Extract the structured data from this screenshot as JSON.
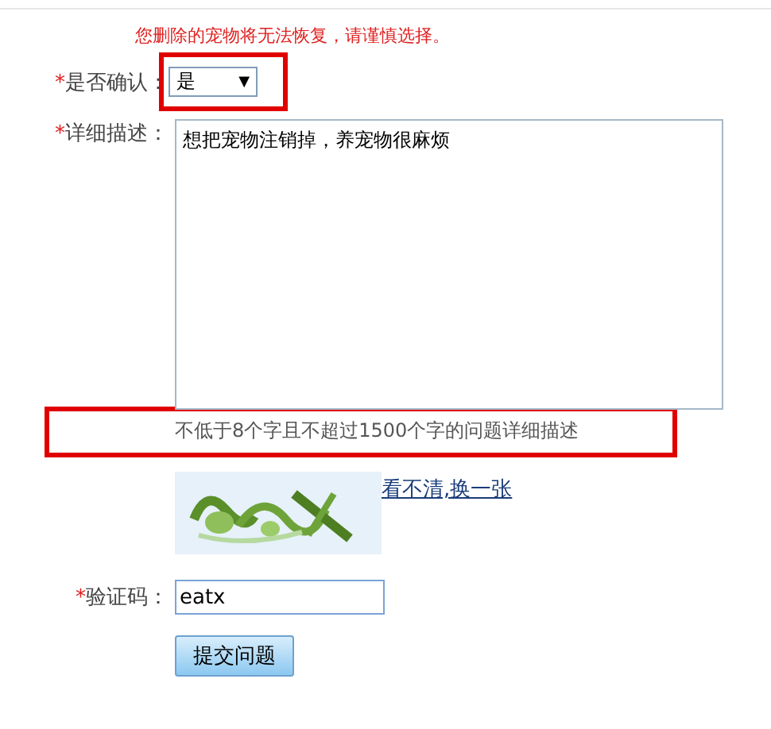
{
  "notice": "您删除的宠物将无法恢复，请谨慎选择。",
  "confirm": {
    "required_mark": "*",
    "label": "是否确认：",
    "value": "是",
    "arrow": "▼",
    "highlighted": true
  },
  "description": {
    "required_mark": "*",
    "label": "详细描述：",
    "value": "想把宠物注销掉，养宠物很麻烦",
    "hint": "不低于8个字且不超过1500个字的问题详细描述",
    "hint_highlighted": true
  },
  "captcha": {
    "refresh_link": "看不清,换一张"
  },
  "code": {
    "required_mark": "*",
    "label": "验证码：",
    "value": "eatx"
  },
  "submit": "提交问题"
}
